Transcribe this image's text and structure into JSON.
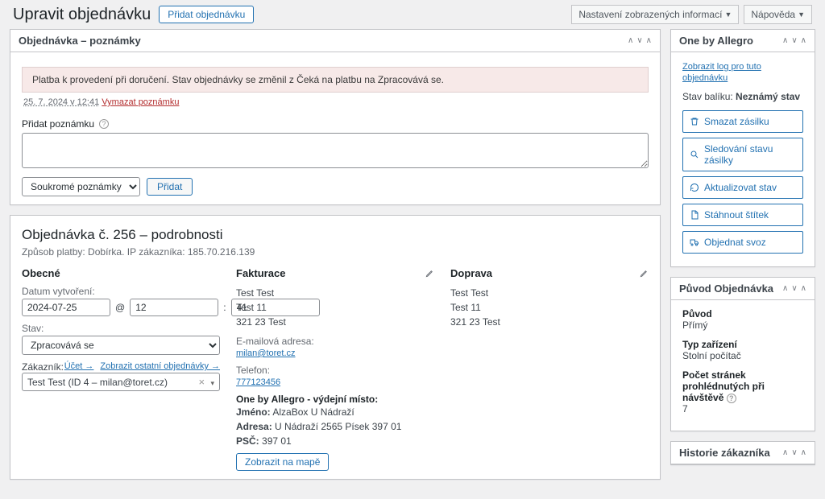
{
  "header": {
    "page_title": "Upravit objednávku",
    "add_order": "Přidat objednávku",
    "screen_options": "Nastavení zobrazených informací",
    "help": "Nápověda"
  },
  "notes_box": {
    "title": "Objednávka – poznámky",
    "note_text": "Platba k provedení při doručení. Stav objednávky se změnil z Čeká na platbu na Zpracovává se.",
    "note_ts": "25. 7. 2024 v 12:41",
    "delete_note": "Vymazat poznámku",
    "add_note_label": "Přidat poznámku",
    "note_type": "Soukromé poznámky",
    "add_btn": "Přidat"
  },
  "order": {
    "title": "Objednávka č. 256 – podrobnosti",
    "subtitle": "Způsob platby: Dobírka. IP zákazníka: 185.70.216.139",
    "general_h": "Obecné",
    "date_lbl": "Datum vytvoření:",
    "date_val": "2024-07-25",
    "hour_val": "12",
    "min_val": "41",
    "at": "@",
    "status_lbl": "Stav:",
    "status_val": "Zpracovává se",
    "customer_lbl": "Zákazník:",
    "profile_link": "Účet →",
    "other_orders_link": "Zobrazit ostatní objednávky →",
    "customer_val": "Test Test (ID 4 – milan@toret.cz)",
    "billing_h": "Fakturace",
    "shipping_h": "Doprava",
    "addr_name": "Test Test",
    "addr_l2": "Test 11",
    "addr_l3": "321 23 Test",
    "email_lbl": "E-mailová adresa:",
    "email_val": "milan@toret.cz",
    "phone_lbl": "Telefon:",
    "phone_val": "777123456",
    "allegro_h": "One by Allegro - výdejní místo:",
    "allegro_name_lbl": "Jméno:",
    "allegro_name": "AlzaBox U Nádraží",
    "allegro_addr_lbl": "Adresa:",
    "allegro_addr": "U Nádraží 2565 Písek 397 01",
    "allegro_psc_lbl": "PSČ:",
    "allegro_psc": "397 01",
    "map_btn": "Zobrazit na mapě"
  },
  "allegro_box": {
    "title": "One by Allegro",
    "log_link": "Zobrazit log pro tuto objednávku",
    "status_lbl": "Stav balíku:",
    "status_val": "Neznámý stav",
    "b1": "Smazat zásilku",
    "b2": "Sledování stavu zásilky",
    "b3": "Aktualizovat stav",
    "b4": "Stáhnout štítek",
    "b5": "Objednat svoz"
  },
  "origin_box": {
    "title": "Původ Objednávka",
    "origin_lbl": "Původ",
    "origin_val": "Přímý",
    "device_lbl": "Typ zařízení",
    "device_val": "Stolní počítač",
    "pages_lbl": "Počet stránek prohlédnutých při návštěvě",
    "pages_val": "7"
  },
  "history_box": {
    "title": "Historie zákazníka"
  }
}
